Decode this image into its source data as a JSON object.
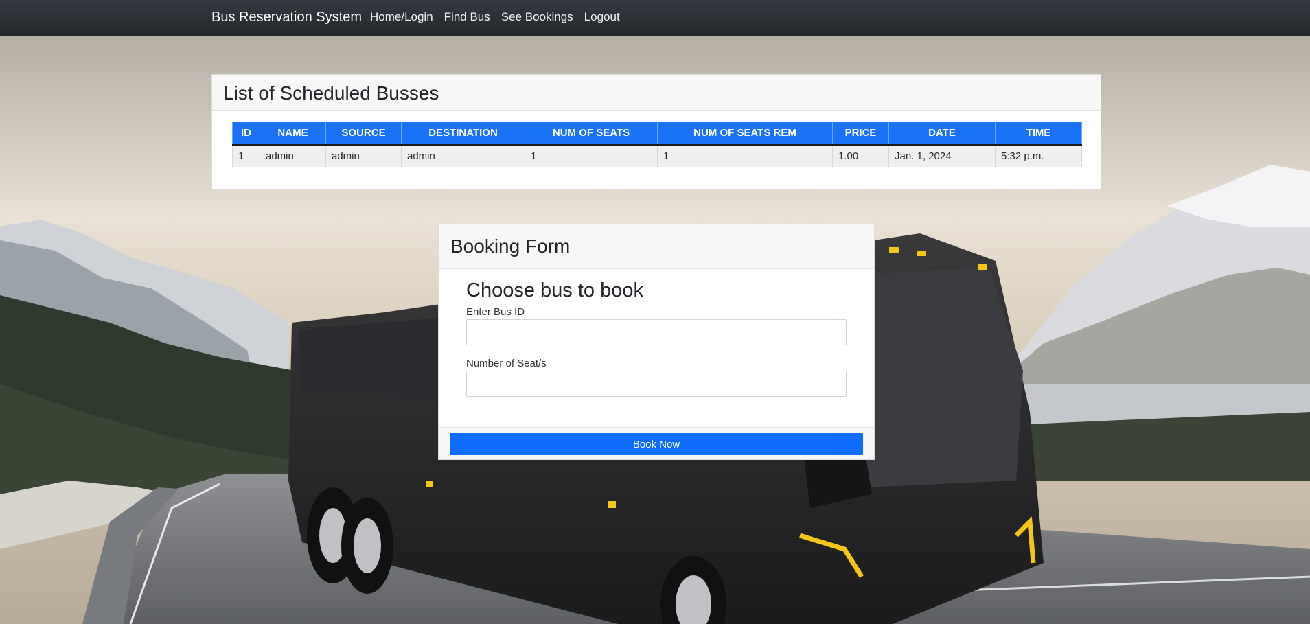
{
  "navbar": {
    "brand": "Bus Reservation System",
    "links": [
      "Home/Login",
      "Find Bus",
      "See Bookings",
      "Logout"
    ]
  },
  "scheduled": {
    "title": "List of Scheduled Busses",
    "columns": [
      "ID",
      "NAME",
      "SOURCE",
      "DESTINATION",
      "NUM OF SEATS",
      "NUM OF SEATS REM",
      "PRICE",
      "DATE",
      "TIME"
    ],
    "rows": [
      [
        "1",
        "admin",
        "admin",
        "admin",
        "1",
        "1",
        "1.00",
        "Jan. 1, 2024",
        "5:32 p.m."
      ]
    ]
  },
  "booking": {
    "title": "Booking Form",
    "heading": "Choose bus to book",
    "bus_id_label": "Enter Bus ID",
    "bus_id_value": "",
    "seats_label": "Number of Seat/s",
    "seats_value": "",
    "submit_label": "Book Now"
  },
  "colors": {
    "navbar": "#343a40",
    "table_header": "#1a73f5",
    "primary_button": "#0d6efd"
  }
}
